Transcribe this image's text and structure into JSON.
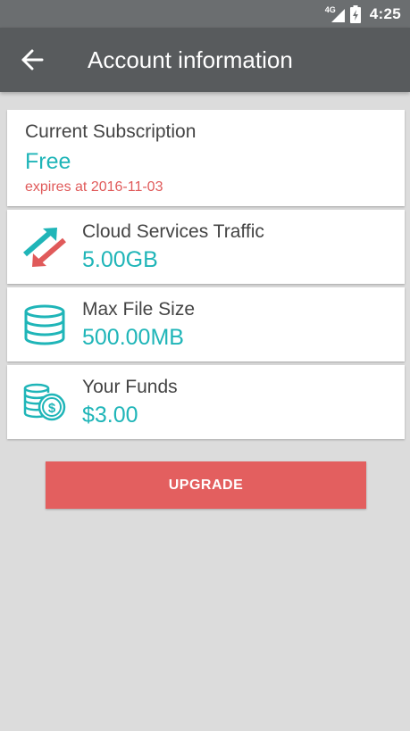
{
  "status_bar": {
    "network": "4G",
    "time": "4:25"
  },
  "app_bar": {
    "title": "Account information",
    "back_icon": "arrow-left-icon"
  },
  "subscription": {
    "label": "Current Subscription",
    "plan": "Free",
    "expiry": "expires at 2016-11-03"
  },
  "traffic": {
    "label": "Cloud Services Traffic",
    "value": "5.00GB",
    "icon": "transfer-arrows-icon"
  },
  "file_size": {
    "label": "Max File Size",
    "value": "500.00MB",
    "icon": "database-icon"
  },
  "funds": {
    "label": "Your Funds",
    "value": "$3.00",
    "icon": "coins-icon"
  },
  "upgrade": {
    "label": "UPGRADE"
  },
  "colors": {
    "accent": "#1fb5b8",
    "danger": "#e05a5a",
    "app_bar": "#585b5d",
    "status_bar": "#6b6e70",
    "background": "#dcdcdc"
  }
}
